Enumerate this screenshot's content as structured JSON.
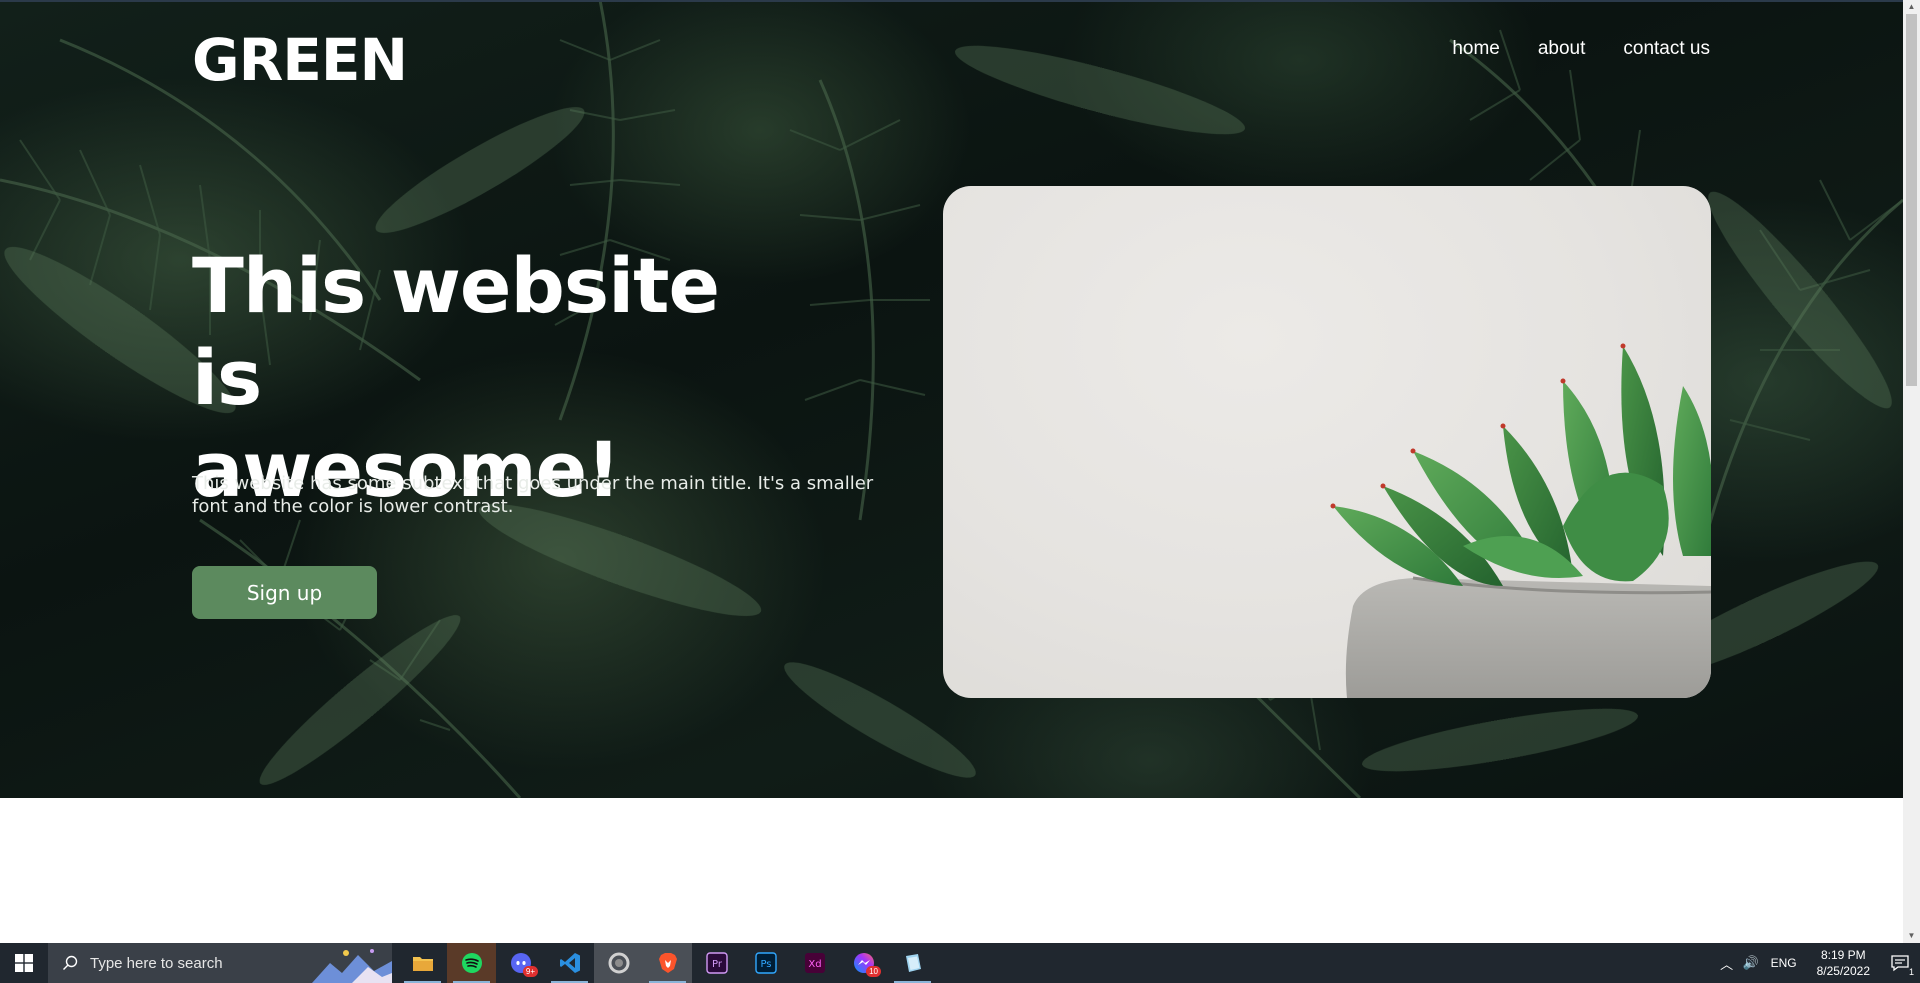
{
  "site": {
    "logo": "GREEN",
    "nav": [
      "home",
      "about",
      "contact us"
    ],
    "headline_line1": "This website is",
    "headline_line2": "awesome!",
    "subtext": "This website has some subtext that goes under the main title. It's a smaller font and the color is lower contrast.",
    "cta_label": "Sign up",
    "colors": {
      "cta": "#5c8a5e",
      "text": "#ffffff",
      "background": "#0d1713"
    }
  },
  "taskbar": {
    "search_placeholder": "Type here to search",
    "apps": [
      {
        "name": "file-explorer",
        "icon": "folder-icon",
        "active": true
      },
      {
        "name": "spotify",
        "icon": "spotify-icon",
        "active": true
      },
      {
        "name": "discord",
        "icon": "discord-icon",
        "badge": "9+"
      },
      {
        "name": "vscode",
        "icon": "vscode-icon",
        "active": true
      },
      {
        "name": "app-ring",
        "icon": "ring-icon",
        "active": false
      },
      {
        "name": "brave",
        "icon": "brave-icon",
        "active": true
      },
      {
        "name": "premiere-pro",
        "icon": "premiere-icon",
        "label": "Pr"
      },
      {
        "name": "photoshop",
        "icon": "photoshop-icon",
        "label": "Ps"
      },
      {
        "name": "adobe-xd",
        "icon": "xd-icon",
        "label": "Xd"
      },
      {
        "name": "messenger",
        "icon": "messenger-icon",
        "badge": "10"
      },
      {
        "name": "notes",
        "icon": "notes-icon",
        "active": true
      }
    ],
    "language": "ENG",
    "time": "8:19 PM",
    "date": "8/25/2022",
    "notification_count": "1"
  }
}
